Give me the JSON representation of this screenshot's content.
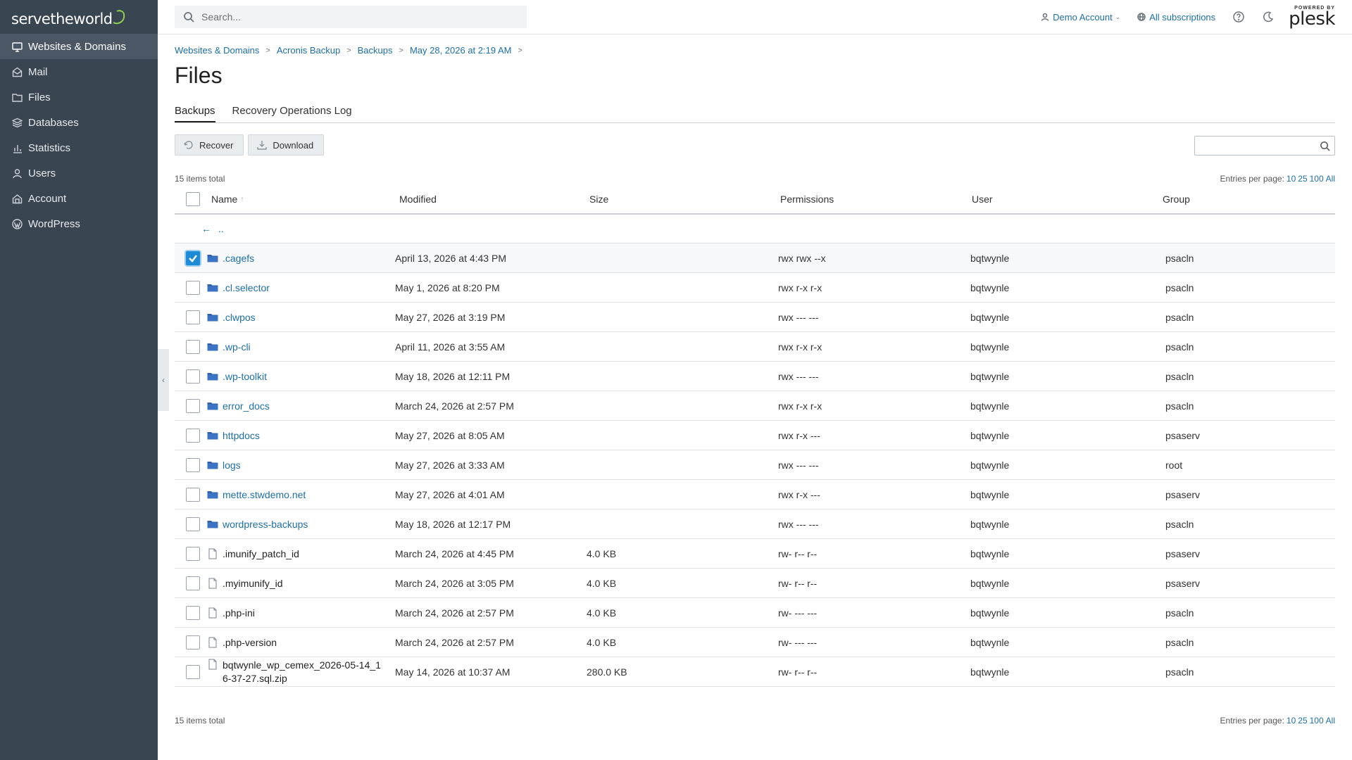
{
  "brand": {
    "logo_text": "servetheworld"
  },
  "sidebar": {
    "items": [
      {
        "label": "Websites & Domains",
        "icon": "monitor-icon",
        "active": true
      },
      {
        "label": "Mail",
        "icon": "mail-icon",
        "active": false
      },
      {
        "label": "Files",
        "icon": "folder-icon",
        "active": false
      },
      {
        "label": "Databases",
        "icon": "database-icon",
        "active": false
      },
      {
        "label": "Statistics",
        "icon": "bar-chart-icon",
        "active": false
      },
      {
        "label": "Users",
        "icon": "user-icon",
        "active": false
      },
      {
        "label": "Account",
        "icon": "account-icon",
        "active": false
      },
      {
        "label": "WordPress",
        "icon": "wordpress-icon",
        "active": false
      }
    ],
    "collapse_glyph": "‹"
  },
  "topbar": {
    "search_placeholder": "Search...",
    "account_label": "Demo Account",
    "subscriptions_label": "All subscriptions",
    "powered_by": "POWERED BY",
    "product": "plesk"
  },
  "breadcrumb": [
    "Websites & Domains",
    "Acronis Backup",
    "Backups",
    "May 28, 2026 at 2:19 AM"
  ],
  "page": {
    "title": "Files"
  },
  "tabs": [
    {
      "label": "Backups",
      "active": true
    },
    {
      "label": "Recovery Operations Log",
      "active": false
    }
  ],
  "toolbar": {
    "recover_label": "Recover",
    "download_label": "Download"
  },
  "list": {
    "items_total": "15 items total",
    "entries_label": "Entries per page:",
    "entries_options": [
      "10",
      "25",
      "100",
      "All"
    ],
    "columns": [
      "Name",
      "Modified",
      "Size",
      "Permissions",
      "User",
      "Group"
    ],
    "sort_indicator": "↑",
    "up_label": "..",
    "rows": [
      {
        "name": ".cagefs",
        "type": "dir",
        "modified": "April 13, 2026 at 4:43 PM",
        "size": "",
        "perm": "rwx rwx --x",
        "user": "bqtwynle",
        "group": "psacln",
        "checked": true
      },
      {
        "name": ".cl.selector",
        "type": "dir",
        "modified": "May 1, 2026 at 8:20 PM",
        "size": "",
        "perm": "rwx r-x r-x",
        "user": "bqtwynle",
        "group": "psacln",
        "checked": false
      },
      {
        "name": ".clwpos",
        "type": "dir",
        "modified": "May 27, 2026 at 3:19 PM",
        "size": "",
        "perm": "rwx --- ---",
        "user": "bqtwynle",
        "group": "psacln",
        "checked": false
      },
      {
        "name": ".wp-cli",
        "type": "dir",
        "modified": "April 11, 2026 at 3:55 AM",
        "size": "",
        "perm": "rwx r-x r-x",
        "user": "bqtwynle",
        "group": "psacln",
        "checked": false
      },
      {
        "name": ".wp-toolkit",
        "type": "dir",
        "modified": "May 18, 2026 at 12:11 PM",
        "size": "",
        "perm": "rwx --- ---",
        "user": "bqtwynle",
        "group": "psacln",
        "checked": false
      },
      {
        "name": "error_docs",
        "type": "dir",
        "modified": "March 24, 2026 at 2:57 PM",
        "size": "",
        "perm": "rwx r-x r-x",
        "user": "bqtwynle",
        "group": "psacln",
        "checked": false
      },
      {
        "name": "httpdocs",
        "type": "dir",
        "modified": "May 27, 2026 at 8:05 AM",
        "size": "",
        "perm": "rwx r-x ---",
        "user": "bqtwynle",
        "group": "psaserv",
        "checked": false
      },
      {
        "name": "logs",
        "type": "dir",
        "modified": "May 27, 2026 at 3:33 AM",
        "size": "",
        "perm": "rwx --- ---",
        "user": "bqtwynle",
        "group": "root",
        "checked": false
      },
      {
        "name": "mette.stwdemo.net",
        "type": "dir",
        "modified": "May 27, 2026 at 4:01 AM",
        "size": "",
        "perm": "rwx r-x ---",
        "user": "bqtwynle",
        "group": "psaserv",
        "checked": false
      },
      {
        "name": "wordpress-backups",
        "type": "dir",
        "modified": "May 18, 2026 at 12:17 PM",
        "size": "",
        "perm": "rwx --- ---",
        "user": "bqtwynle",
        "group": "psacln",
        "checked": false
      },
      {
        "name": ".imunify_patch_id",
        "type": "file",
        "modified": "March 24, 2026 at 4:45 PM",
        "size": "4.0 KB",
        "perm": "rw- r-- r--",
        "user": "bqtwynle",
        "group": "psaserv",
        "checked": false
      },
      {
        "name": ".myimunify_id",
        "type": "file",
        "modified": "March 24, 2026 at 3:05 PM",
        "size": "4.0 KB",
        "perm": "rw- r-- r--",
        "user": "bqtwynle",
        "group": "psaserv",
        "checked": false
      },
      {
        "name": ".php-ini",
        "type": "file",
        "modified": "March 24, 2026 at 2:57 PM",
        "size": "4.0 KB",
        "perm": "rw- --- ---",
        "user": "bqtwynle",
        "group": "psacln",
        "checked": false
      },
      {
        "name": ".php-version",
        "type": "file",
        "modified": "March 24, 2026 at 2:57 PM",
        "size": "4.0 KB",
        "perm": "rw- --- ---",
        "user": "bqtwynle",
        "group": "psacln",
        "checked": false
      },
      {
        "name": "bqtwynle_wp_cemex_2026-05-14_16-37-27.sql.zip",
        "type": "file",
        "modified": "May 14, 2026 at 10:37 AM",
        "size": "280.0 KB",
        "perm": "rw- r-- r--",
        "user": "bqtwynle",
        "group": "psacln",
        "checked": false
      }
    ]
  },
  "colors": {
    "sidebar_bg": "#3a4552",
    "link": "#1d6fa5",
    "folder": "#2f5fa8",
    "checkbox_on": "#1d8ad6"
  }
}
